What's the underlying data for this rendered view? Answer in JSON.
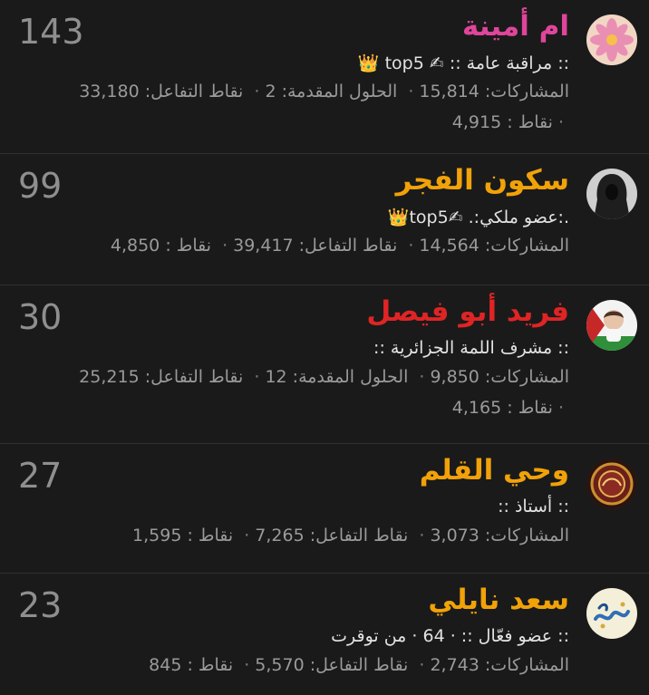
{
  "members": [
    {
      "name": "ام أمينة",
      "count": "143",
      "title": ":: مراقبة عامة :: ✍ top5 👑",
      "stats": [
        {
          "label": "المشاركات:",
          "value": "15,814"
        },
        {
          "label": "الحلول المقدمة:",
          "value": "2"
        },
        {
          "label": "نقاط التفاعل:",
          "value": "33,180"
        }
      ],
      "points": {
        "label": "نقاط :",
        "value": "4,915"
      },
      "name_color": "#e0459b"
    },
    {
      "name": "سكون الفجر",
      "count": "99",
      "title": ".:عضو ملكي:. ✍top5👑",
      "stats": [
        {
          "label": "المشاركات:",
          "value": "14,564"
        },
        {
          "label": "نقاط التفاعل:",
          "value": "39,417"
        },
        {
          "label": "نقاط :",
          "value": "4,850"
        }
      ],
      "name_color": "#f1a208"
    },
    {
      "name": "فريد أبو فيصل",
      "count": "30",
      "title": ":: مشرف اللمة الجزائرية ::",
      "stats": [
        {
          "label": "المشاركات:",
          "value": "9,850"
        },
        {
          "label": "الحلول المقدمة:",
          "value": "12"
        },
        {
          "label": "نقاط التفاعل:",
          "value": "25,215"
        }
      ],
      "points": {
        "label": "نقاط :",
        "value": "4,165"
      },
      "name_color": "#e02424"
    },
    {
      "name": "وحي القلم",
      "count": "27",
      "title": ":: أستاذ ::",
      "stats": [
        {
          "label": "المشاركات:",
          "value": "3,073"
        },
        {
          "label": "نقاط التفاعل:",
          "value": "7,265"
        },
        {
          "label": "نقاط :",
          "value": "1,595"
        }
      ],
      "name_color": "#f1a208"
    },
    {
      "name": "سعد نايلي",
      "count": "23",
      "title": ":: عضو فعّال :: · 64 · من توقرت",
      "stats": [
        {
          "label": "المشاركات:",
          "value": "2,743"
        },
        {
          "label": "نقاط التفاعل:",
          "value": "5,570"
        },
        {
          "label": "نقاط :",
          "value": "845"
        }
      ],
      "name_color": "#f1a208"
    }
  ],
  "avatar_icons": [
    "pink-flower-avatar",
    "hooded-figure-avatar",
    "child-flag-avatar",
    "ornament-avatar",
    "calligraphy-avatar"
  ]
}
